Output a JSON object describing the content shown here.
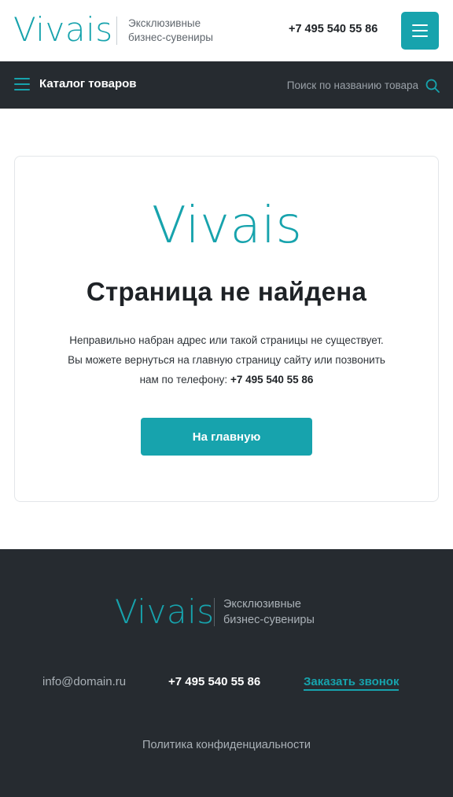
{
  "header": {
    "logo_text": "Vivais",
    "tagline_line1": "Эксклюзивные",
    "tagline_line2": "бизнес-сувениры",
    "phone": "+7 495 540 55 86",
    "menu_icon": "hamburger-menu-icon"
  },
  "nav": {
    "catalog_label": "Каталог товаров",
    "catalog_icon": "hamburger-menu-icon",
    "search_placeholder": "Поиск по названию товара",
    "search_icon": "search-icon"
  },
  "error_page": {
    "logo_text": "Vivais",
    "title": "Страница не найдена",
    "message_line1": "Неправильно набран адрес или такой страницы не существует.",
    "message_line2": "Вы можете вернуться на главную страницу сайту или позвонить",
    "message_line3": "нам по телефону:",
    "phone": "+7 495 540 55 86",
    "home_button": "На главную"
  },
  "footer": {
    "logo_text": "Vivais",
    "tagline_line1": "Эксклюзивные",
    "tagline_line2": "бизнес-сувениры",
    "email": "info@domain.ru",
    "phone": "+7 495 540 55 86",
    "callback_link": "Заказать звонок",
    "privacy_link": "Политика конфиденциальности"
  },
  "colors": {
    "accent": "#17a3ad",
    "dark": "#262b30",
    "text": "#1e2226"
  }
}
